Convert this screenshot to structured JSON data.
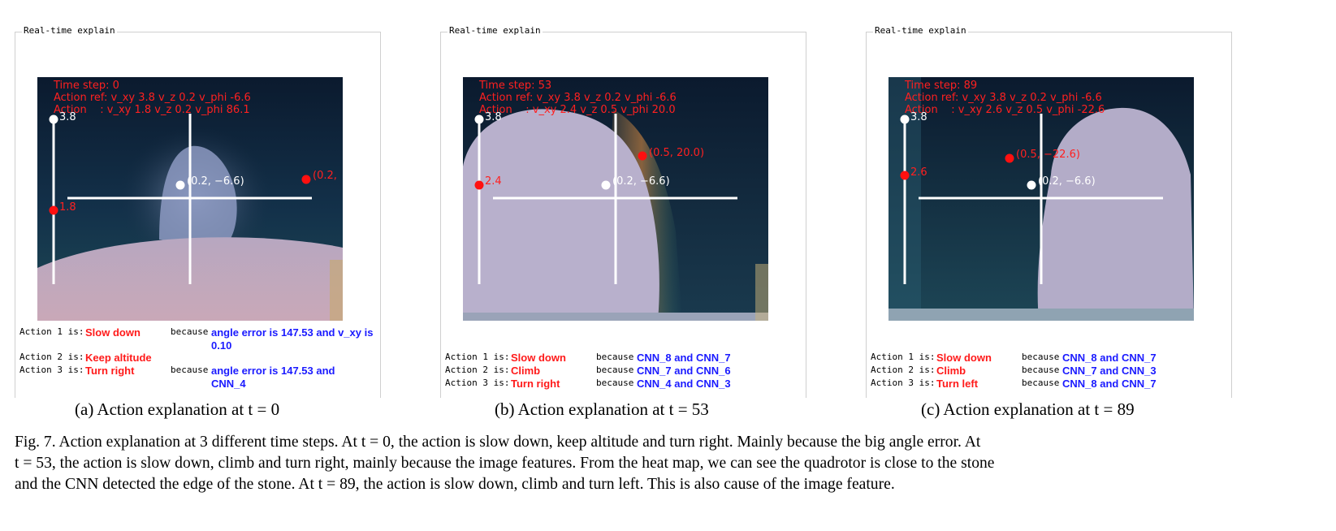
{
  "panels": [
    {
      "frame_title": "Real-time explain",
      "hud": {
        "time_step": "Time step: 0",
        "action_ref": "Action ref: v_xy 3.8 v_z 0.2 v_phi -6.6",
        "action": "Action    : v_xy 1.8 v_z 0.2 v_phi 86.1"
      },
      "labels": {
        "top_value": "3.8",
        "actual_xy": "1.8",
        "ref_point": "(0.2, −6.6)",
        "act_point": "(0.2,"
      },
      "actions": [
        {
          "key": "Action 1 is:",
          "action": "Slow down",
          "because": "because",
          "reason": "angle error is 147.53 and v_xy is 0.10"
        },
        {
          "key": "Action 2 is:",
          "action": "Keep altitude",
          "because": "",
          "reason": ""
        },
        {
          "key": "Action 3 is:",
          "action": "Turn right",
          "because": "because",
          "reason": "angle error is 147.53 and CNN_4"
        }
      ],
      "subcaption": "(a) Action explanation at t = 0"
    },
    {
      "frame_title": "Real-time explain",
      "hud": {
        "time_step": "Time step: 53",
        "action_ref": "Action ref: v_xy 3.8 v_z 0.2 v_phi -6.6",
        "action": "Action    : v_xy 2.4 v_z 0.5 v_phi 20.0"
      },
      "labels": {
        "top_value": "3.8",
        "actual_xy": "2.4",
        "ref_point": "(0.2, −6.6)",
        "act_point": "(0.5, 20.0)"
      },
      "actions": [
        {
          "key": "Action 1 is:",
          "action": "Slow down",
          "because": "because",
          "reason": "CNN_8 and CNN_7"
        },
        {
          "key": "Action 2 is:",
          "action": "Climb",
          "because": "because",
          "reason": "CNN_7 and CNN_6"
        },
        {
          "key": "Action 3 is:",
          "action": "Turn right",
          "because": "because",
          "reason": "CNN_4 and CNN_3"
        }
      ],
      "subcaption": "(b) Action explanation at t = 53"
    },
    {
      "frame_title": "Real-time explain",
      "hud": {
        "time_step": "Time step: 89",
        "action_ref": "Action ref: v_xy 3.8 v_z 0.2 v_phi -6.6",
        "action": "Action    : v_xy 2.6 v_z 0.5 v_phi -22.6"
      },
      "labels": {
        "top_value": "3.8",
        "actual_xy": "2.6",
        "ref_point": "(0.2, −6.6)",
        "act_point": "(0.5, −22.6)"
      },
      "actions": [
        {
          "key": "Action 1 is:",
          "action": "Slow down",
          "because": "because",
          "reason": "CNN_8 and CNN_7"
        },
        {
          "key": "Action 2 is:",
          "action": "Climb",
          "because": "because",
          "reason": "CNN_7 and CNN_3"
        },
        {
          "key": "Action 3 is:",
          "action": "Turn left",
          "because": "because",
          "reason": "CNN_8 and CNN_7"
        }
      ],
      "subcaption": "(c) Action explanation at t = 89"
    }
  ],
  "figure_caption": {
    "line1": "Fig. 7.  Action explanation at 3 different time steps. At t = 0, the action is slow down, keep altitude and turn right. Mainly because the big angle error. At",
    "line2": "t = 53, the action is slow down, climb and turn right, mainly because the image features. From the heat map, we can see the quadrotor is close to the stone",
    "line3": "and the CNN detected the edge of the stone. At t = 89, the action is slow down, climb and turn left. This is also cause of the image feature."
  },
  "colors": {
    "action_text": "#ff1a1a",
    "reason_text": "#1a1aff",
    "hud_text": "#ff2020",
    "scene_sky": "#0d1f33",
    "stone": "#b9b3cf",
    "ground": "#a898b4"
  }
}
